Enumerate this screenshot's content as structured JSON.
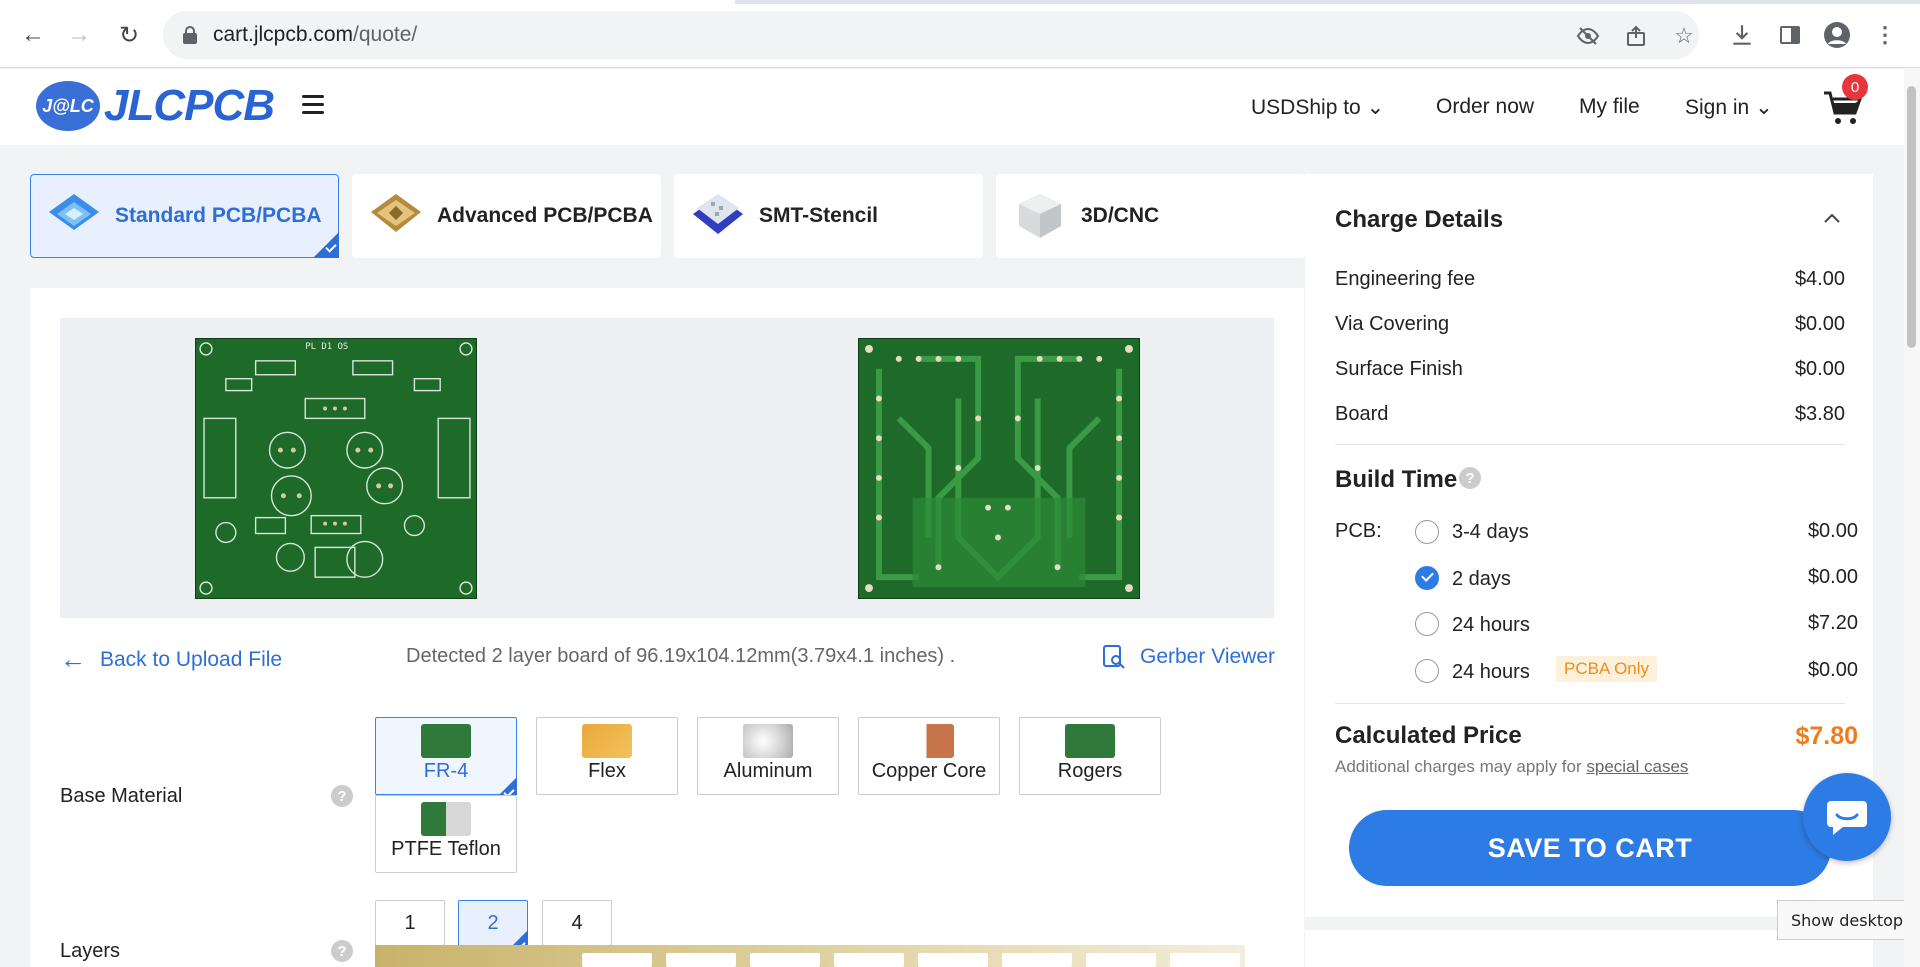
{
  "browser": {
    "url_host": "cart.jlcpcb.com",
    "url_path": "/quote/"
  },
  "header": {
    "logo_mark": "J@LC",
    "logo_text": "JLCPCB",
    "currency": "USDShip to",
    "order_now": "Order now",
    "my_file": "My file",
    "sign_in": "Sign in",
    "cart_count": "0"
  },
  "product_tabs": [
    {
      "label": "Standard PCB/PCBA",
      "active": true
    },
    {
      "label": "Advanced PCB/PCBA",
      "active": false
    },
    {
      "label": "SMT-Stencil",
      "active": false
    },
    {
      "label": "3D/CNC",
      "active": false
    }
  ],
  "preview": {
    "top_silk_title": "PL D1 OS",
    "back_link": "Back to Upload File",
    "detected": "Detected 2 layer board of 96.19x104.12mm(3.79x4.1 inches) .",
    "gerber_viewer": "Gerber Viewer"
  },
  "options": {
    "base_material_label": "Base Material",
    "materials": [
      "FR-4",
      "Flex",
      "Aluminum",
      "Copper Core",
      "Rogers",
      "PTFE Teflon"
    ],
    "selected_material": "FR-4",
    "layers_label": "Layers",
    "layers": [
      "1",
      "2",
      "4"
    ],
    "selected_layers": "2",
    "help_mark": "?"
  },
  "charges": {
    "title": "Charge Details",
    "rows": [
      {
        "label": "Engineering fee",
        "value": "$4.00"
      },
      {
        "label": "Via Covering",
        "value": "$0.00"
      },
      {
        "label": "Surface Finish",
        "value": "$0.00"
      },
      {
        "label": "Board",
        "value": "$3.80"
      }
    ],
    "build_time_title": "Build Time",
    "pcb_label": "PCB:",
    "build_options": [
      {
        "label": "3-4 days",
        "price": "$0.00",
        "checked": false
      },
      {
        "label": "2 days",
        "price": "$0.00",
        "checked": true
      },
      {
        "label": "24 hours",
        "price": "$7.20",
        "checked": false
      },
      {
        "label": "24 hours",
        "price": "$0.00",
        "checked": false,
        "badge": "PCBA Only"
      }
    ],
    "calc_title": "Calculated Price",
    "calc_price": "$7.80",
    "calc_note": "Additional charges may apply for ",
    "calc_note_link": "special cases",
    "save_button": "SAVE TO CART"
  },
  "tooltip": "Show desktop",
  "colors": {
    "accent": "#2d7be5",
    "price_orange": "#f07b1a",
    "pcb_green": "#1f6b2a"
  }
}
